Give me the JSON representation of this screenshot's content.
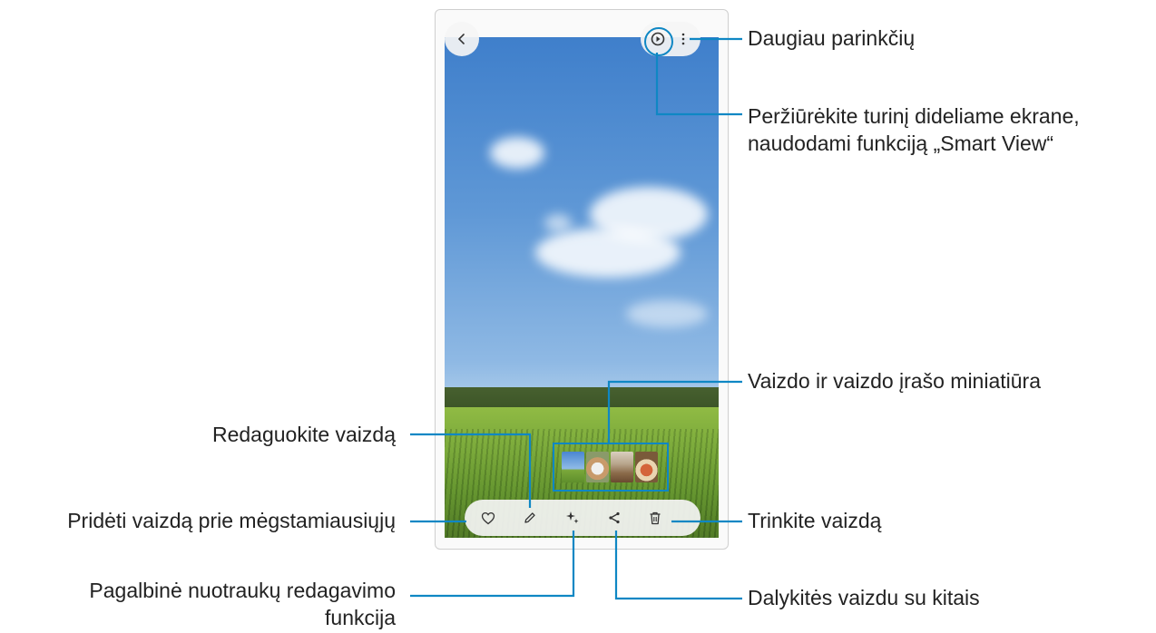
{
  "labels": {
    "more_options": "Daugiau parinkčių",
    "smart_view_line1": "Peržiūrėkite turinį dideliame ekrane,",
    "smart_view_line2": "naudodami funkciją „Smart View“",
    "thumbnails": "Vaizdo ir vaizdo įrašo miniatiūra",
    "edit": "Redaguokite vaizdą",
    "favourite": "Pridėti vaizdą prie mėgstamiausiųjų",
    "delete": "Trinkite vaizdą",
    "assist_line1": "Pagalbinė nuotraukų redagavimo",
    "assist_line2": "funkcija",
    "share": "Dalykitės vaizdu su kitais"
  },
  "icons": {
    "back": "chevron-left-icon",
    "smart_view": "smart-view-icon",
    "more": "more-vertical-icon",
    "favourite": "heart-icon",
    "edit": "pencil-icon",
    "ai_edit": "sparkle-icon",
    "share": "share-icon",
    "delete": "trash-icon"
  },
  "colors": {
    "callout": "#0f87c4"
  }
}
